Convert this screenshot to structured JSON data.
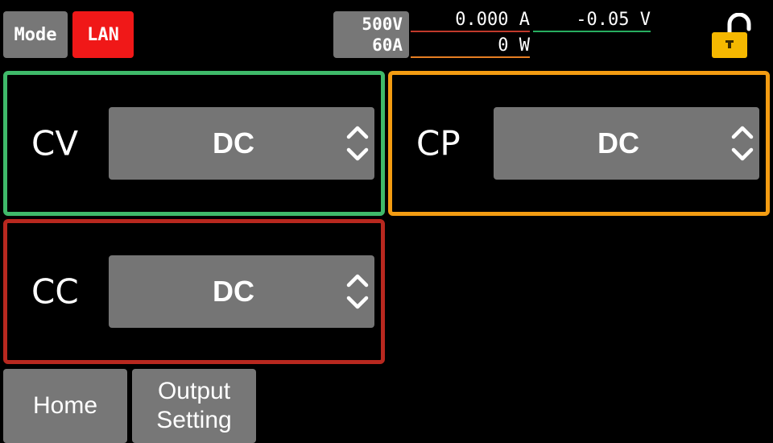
{
  "header": {
    "mode_label": "Mode",
    "interface_badge": "LAN",
    "rating_voltage": "500V",
    "rating_current": "60A",
    "current_reading": "0.000 A",
    "voltage_reading": "-0.05 V",
    "power_reading": "0 W",
    "lock_state": "unlocked",
    "lock_icon": "open-padlock-icon"
  },
  "panels": {
    "cv": {
      "label": "CV",
      "value": "DC",
      "color": "#3fba6a"
    },
    "cp": {
      "label": "CP",
      "value": "DC",
      "color": "#f39c12"
    },
    "cc": {
      "label": "CC",
      "value": "DC",
      "color": "#b8281f"
    }
  },
  "footer": {
    "home_label": "Home",
    "output_setting_line1": "Output",
    "output_setting_line2": "Setting"
  },
  "colors": {
    "lan_badge": "#f01818",
    "button_gray": "#777777",
    "lock": "#f5b800"
  }
}
